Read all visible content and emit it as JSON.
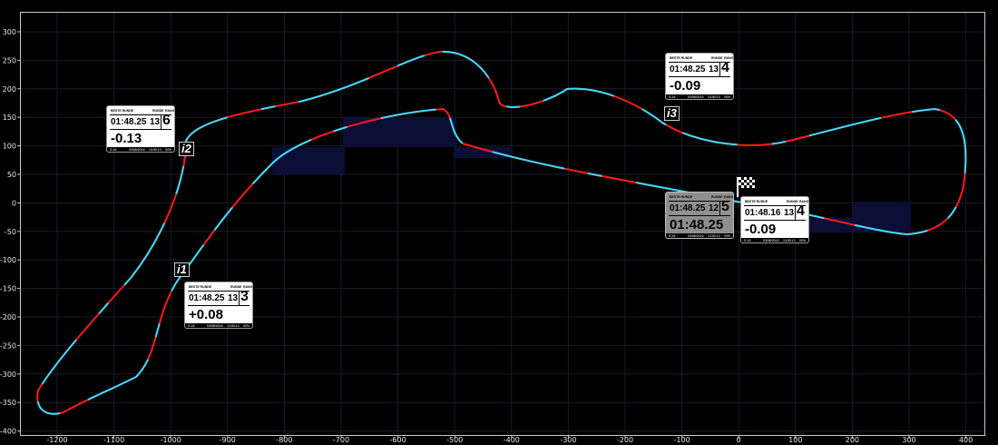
{
  "axes": {
    "x_ticks": [
      "-1200",
      "-1100",
      "-1000",
      "-900",
      "-800",
      "-700",
      "-600",
      "-500",
      "-400",
      "-300",
      "-200",
      "-100",
      "0",
      "100",
      "200",
      "300",
      "400"
    ],
    "y_ticks": [
      "300",
      "250",
      "200",
      "150",
      "100",
      "50",
      "0",
      "-50",
      "-100",
      "-150",
      "-200",
      "-250",
      "-300",
      "-350",
      "-400"
    ]
  },
  "colors": {
    "background": "#000000",
    "track_slower": "#ff1a1a",
    "track_faster": "#39dcff",
    "sector_band": "#0b0e35"
  },
  "markers": [
    {
      "id": "i1",
      "label": "i1"
    },
    {
      "id": "i2",
      "label": "i2"
    },
    {
      "id": "i3",
      "label": "i3"
    }
  ],
  "finish_flag": {
    "icon": "checkered-flag-icon"
  },
  "cards": [
    {
      "id": "i2",
      "header_best": "BESTE RUNDE",
      "header_lap": "RUNDE",
      "header_rank": "RANG",
      "best_time": "01:48.25",
      "lap": "13",
      "rank": "6",
      "delta": "-0.13",
      "foot_1": "S-18",
      "foot_2": "03/08/2016",
      "foot_3": "13:50:13",
      "foot_4": "00%"
    },
    {
      "id": "i3",
      "header_best": "BESTE RUNDE",
      "header_lap": "RUNDE",
      "header_rank": "RANG",
      "best_time": "01:48.25",
      "lap": "13",
      "rank": "4",
      "delta": "-0.09",
      "foot_1": "S-18",
      "foot_2": "03/08/2016",
      "foot_3": "13:50:13",
      "foot_4": "00%"
    },
    {
      "id": "i1",
      "header_best": "BESTE RUNDE",
      "header_lap": "RUNDE",
      "header_rank": "RANG",
      "best_time": "01:48.25",
      "lap": "13",
      "rank": "3",
      "delta": "+0.08",
      "foot_1": "S-18",
      "foot_2": "03/08/2016",
      "foot_3": "13:50:13",
      "foot_4": "00%"
    },
    {
      "id": "finish-best",
      "header_best": "BESTE RUNDE",
      "header_lap": "RUNDE",
      "header_rank": "RANG",
      "best_time": "01:48.25",
      "lap": "12",
      "rank": "5",
      "delta": "01:48.25",
      "foot_1": "S-18",
      "foot_2": "03/08/2016",
      "foot_3": "13:50:13",
      "foot_4": "00%"
    },
    {
      "id": "finish",
      "header_best": "BESTE RUNDE",
      "header_lap": "RUNDE",
      "header_rank": "RANG",
      "best_time": "01:48.16",
      "lap": "13",
      "rank": "4",
      "delta": "-0.09",
      "foot_1": "S-18",
      "foot_2": "03/08/2016",
      "foot_3": "13:50:13",
      "foot_4": "00%"
    }
  ]
}
